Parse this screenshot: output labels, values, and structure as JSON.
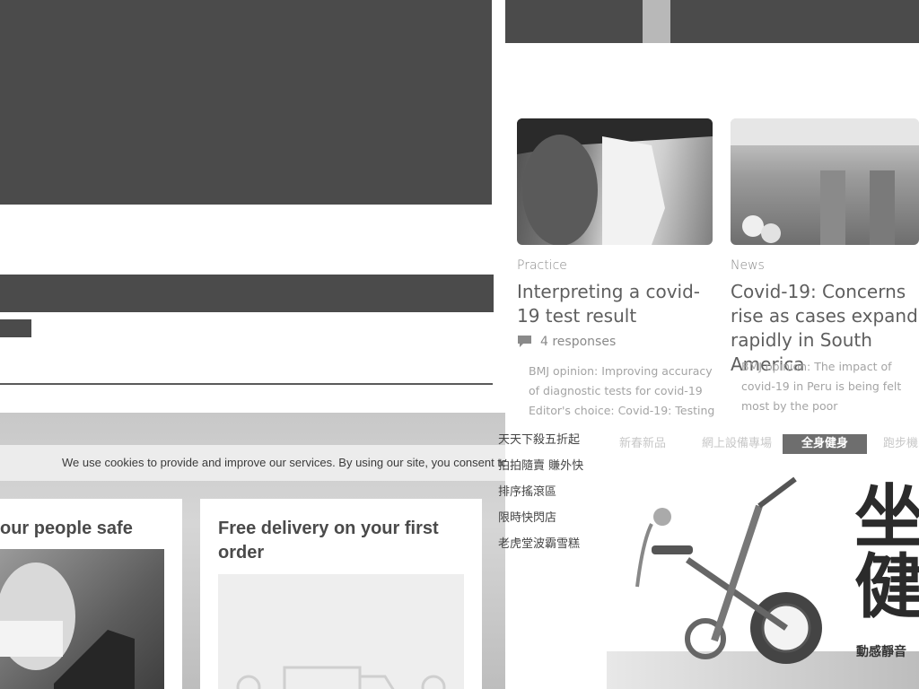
{
  "left": {
    "cookie_text": "We use cookies to provide and improve our services. By using our site, you consent to",
    "card1_title": "our people safe",
    "card2_title": "Free delivery on your first order"
  },
  "articles": [
    {
      "category": "Practice",
      "title": "Interpreting a covid-19 test result",
      "responses": "4 responses",
      "snippet": "BMJ opinion: Improving accuracy of diagnostic tests for covid-19 Editor's choice: Covid-19: Testing"
    },
    {
      "category": "News",
      "title": "Covid-19: Concerns rise as cases expand rapidly in South America",
      "snippet": "BMJ opinion: The impact of covid-19 in Peru is being felt most by the poor"
    }
  ],
  "shop": {
    "list": [
      "天天下殺五折起",
      "拍拍隨賣 賺外快",
      "排序搖滾區",
      "限時快閃店",
      "老虎堂波霸雪糕"
    ],
    "nav": [
      "新春新品",
      "網上設備專場",
      "全身健身",
      "跑步機"
    ],
    "banner_big": "坐健",
    "banner_sub": "動感靜音"
  },
  "colors": {
    "dark_block": "#4b4b4b",
    "active_tab": "#6e6e6e"
  }
}
